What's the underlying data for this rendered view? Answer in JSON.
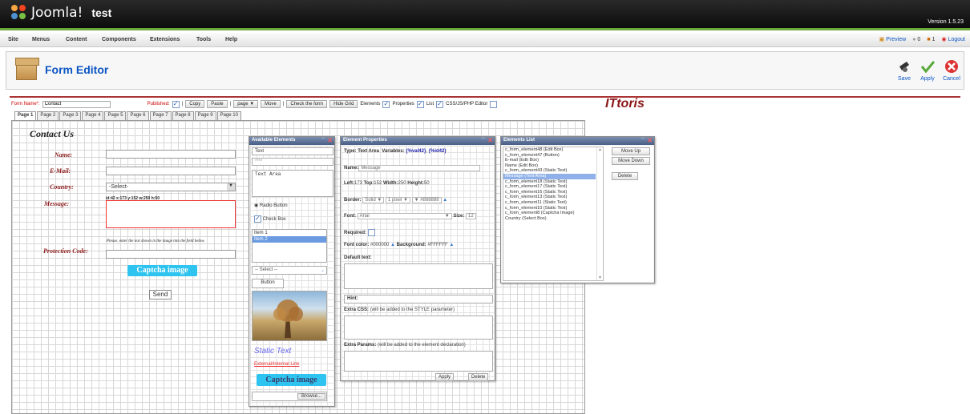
{
  "app": {
    "brand": "Joomla!",
    "site": "test",
    "version": "Version 1.5.23"
  },
  "menu": [
    "Site",
    "Menus",
    "Content",
    "Components",
    "Extensions",
    "Tools",
    "Help"
  ],
  "status": {
    "preview": "Preview",
    "visitors": "0",
    "users": "1",
    "logout": "Logout"
  },
  "page": {
    "title": "Form Editor"
  },
  "toolbar": {
    "save": "Save",
    "apply": "Apply",
    "cancel": "Cancel"
  },
  "formbar": {
    "name_label": "Form Name*:",
    "name_value": "Contact",
    "published": "Published:",
    "copy": "Copy",
    "paste": "Paste",
    "page_select": "page",
    "move": "Move",
    "check": "Check the form",
    "hide_grid": "Hide Grid",
    "elements": "Elements",
    "properties": "Properties",
    "list": "List",
    "css": "CSS/JS/PHP Editor",
    "sep": "|"
  },
  "brand_right": "ITtoris",
  "tabs": [
    "Page 1",
    "Page 2",
    "Page 3",
    "Page 4",
    "Page 5",
    "Page 6",
    "Page 7",
    "Page 8",
    "Page 9",
    "Page 10"
  ],
  "form": {
    "heading": "Contact Us",
    "name": "Name:",
    "email": "E-Mail:",
    "country": "Country:",
    "country_val": "-Select-",
    "message": "Message:",
    "coords": "id:42 x:173 y:152 w:250 h:50",
    "hint": "Please, enter the text shown in the image into the field below.",
    "protection": "Protection Code:",
    "captcha": "Captcha image",
    "send": "Send"
  },
  "available": {
    "title": "Available Elements",
    "text": "Text",
    "password": "****",
    "textarea": "Text Area",
    "radio": "Radio Button",
    "check": "Check Box",
    "item1": "Item 1",
    "item2": "Item 2",
    "select": "-- Select --",
    "button": "Button",
    "static": "Static Text",
    "link": "External/Internal Link",
    "captcha": "Captcha image",
    "browse": "Browse..."
  },
  "props": {
    "title": "Element Properties",
    "type": "Type: Text Area",
    "variables": "Variables:",
    "var1": "{%val42}",
    "var2": "{%id42}",
    "name_lbl": "Name:",
    "name_val": "Message",
    "left_lbl": "Left:",
    "left": "173",
    "top_lbl": "Top:",
    "top": "152",
    "width_lbl": "Width:",
    "width": "250",
    "height_lbl": "Height:",
    "height": "50",
    "border_lbl": "Border:",
    "border_style": "Solid",
    "border_size": "1 pixel",
    "border_color": "#888888",
    "font_lbl": "Font:",
    "font_val": "Arial",
    "size_lbl": "Size:",
    "size": "12",
    "required": "Required:",
    "fontcolor_lbl": "Font color:",
    "fontcolor": "#000000",
    "bg_lbl": "Background:",
    "bg": "#FFFFFF",
    "default": "Default text:",
    "hint": "Hint:",
    "extracss": "Extra CSS:",
    "extracss_note": "(will be added to the STYLE parameter)",
    "extraparams": "Extra Params:",
    "extraparams_note": "(will be added to the element declaration)",
    "apply": "Apply",
    "delete": "Delete"
  },
  "elist": {
    "title": "Elements List",
    "items": [
      "c_form_element48 (Edit Box)",
      "c_form_element47 (Button)",
      "E-mail (Edit Box)",
      "Name (Edit Box)",
      "c_form_element43 (Static Text)",
      "Message (Text Area)",
      "c_form_element18 (Static Text)",
      "c_form_element17 (Static Text)",
      "c_form_element16 (Static Text)",
      "c_form_element13 (Static Text)",
      "c_form_element11 (Static Text)",
      "c_form_element10 (Static Text)",
      "c_form_element8 (Captcha Image)",
      "Country (Select Box)"
    ],
    "up": "Move Up",
    "down": "Move Down",
    "delete": "Delete"
  }
}
